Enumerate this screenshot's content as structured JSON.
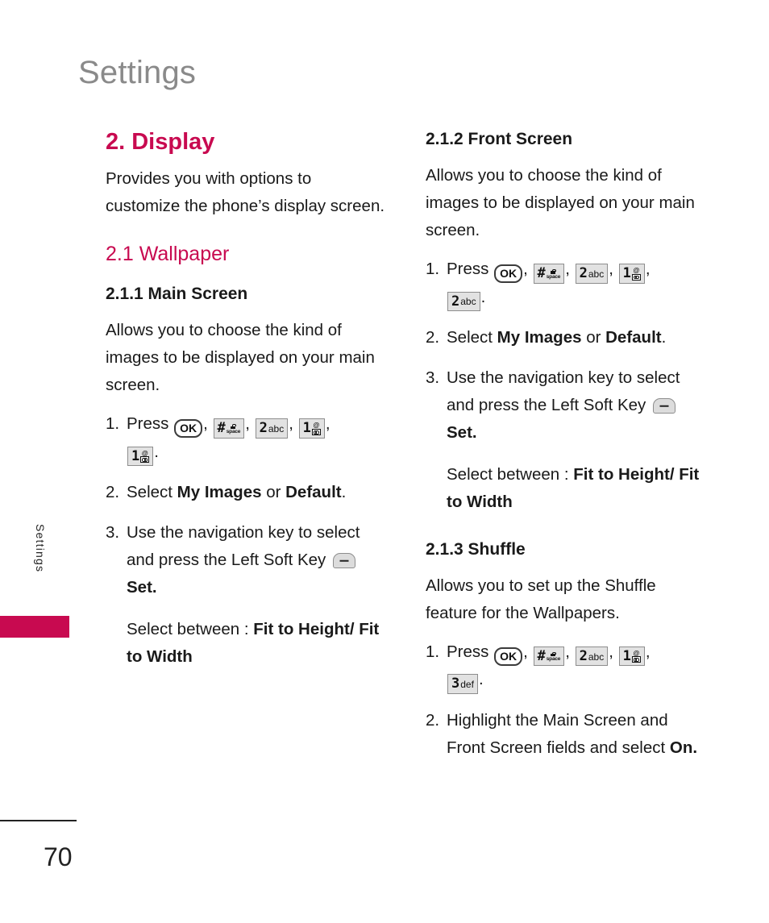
{
  "page": {
    "header_title": "Settings",
    "side_tab_label": "Settings",
    "page_number": "70",
    "accent_color": "#c80a50",
    "header_color": "#8a8a8a"
  },
  "keys": {
    "ok": {
      "label": "OK",
      "name": "ok-key"
    },
    "hash_space": {
      "digit": "#",
      "sub_top": "lock-icon",
      "sub_bottom": "space",
      "name": "hash-space-key"
    },
    "two_abc": {
      "digit": "2",
      "side": "abc",
      "name": "two-abc-key"
    },
    "one_voicemail": {
      "digit": "1",
      "sub_top": "@",
      "sub_bottom": "voicemail-icon",
      "name": "one-voicemail-key"
    },
    "three_def": {
      "digit": "3",
      "side": "def",
      "name": "three-def-key"
    },
    "left_soft": {
      "name": "left-soft-key"
    }
  },
  "left_column": {
    "section_title": "2. Display",
    "intro": "Provides you with options to customize the phone’s display screen.",
    "subsection_title": "2.1 Wallpaper",
    "topic_title": "2.1.1 Main Screen",
    "topic_intro": "Allows you to choose the kind of images to be displayed on your main screen.",
    "steps": [
      {
        "num": "1.",
        "prefix": "Press",
        "keys": [
          "ok",
          "hash_space",
          "two_abc",
          "one_voicemail",
          "one_voicemail"
        ],
        "suffix": "."
      },
      {
        "num": "2.",
        "text_parts": [
          "Select ",
          "My Images",
          " or ",
          "Default",
          "."
        ]
      },
      {
        "num": "3.",
        "text_before": "Use the navigation key to select and press the Left Soft Key",
        "key": "left_soft",
        "text_after": "Set.",
        "note_label": "Select between : ",
        "note_bold": "Fit to Height/ Fit to Width"
      }
    ]
  },
  "right_column": {
    "topic_2_title": "2.1.2 Front Screen",
    "topic_2_intro": "Allows you to choose the kind of images to be displayed on your main screen.",
    "topic_2_steps": [
      {
        "num": "1.",
        "prefix": "Press",
        "keys": [
          "ok",
          "hash_space",
          "two_abc",
          "one_voicemail",
          "two_abc"
        ],
        "suffix": "."
      },
      {
        "num": "2.",
        "text_parts": [
          "Select ",
          "My Images",
          " or ",
          "Default",
          "."
        ]
      },
      {
        "num": "3.",
        "text_before": "Use the navigation key to select and press the Left Soft Key",
        "key": "left_soft",
        "text_after": "Set.",
        "note_label": "Select between : ",
        "note_bold": "Fit to Height/ Fit to Width"
      }
    ],
    "topic_3_title": "2.1.3 Shuffle",
    "topic_3_intro": "Allows you to set up the Shuffle feature for the Wallpapers.",
    "topic_3_steps": [
      {
        "num": "1.",
        "prefix": "Press",
        "keys": [
          "ok",
          "hash_space",
          "two_abc",
          "one_voicemail",
          "three_def"
        ],
        "suffix": "."
      },
      {
        "num": "2.",
        "text_before": "Highlight the Main Screen and Front Screen fields and select",
        "text_bold": "On."
      }
    ]
  }
}
